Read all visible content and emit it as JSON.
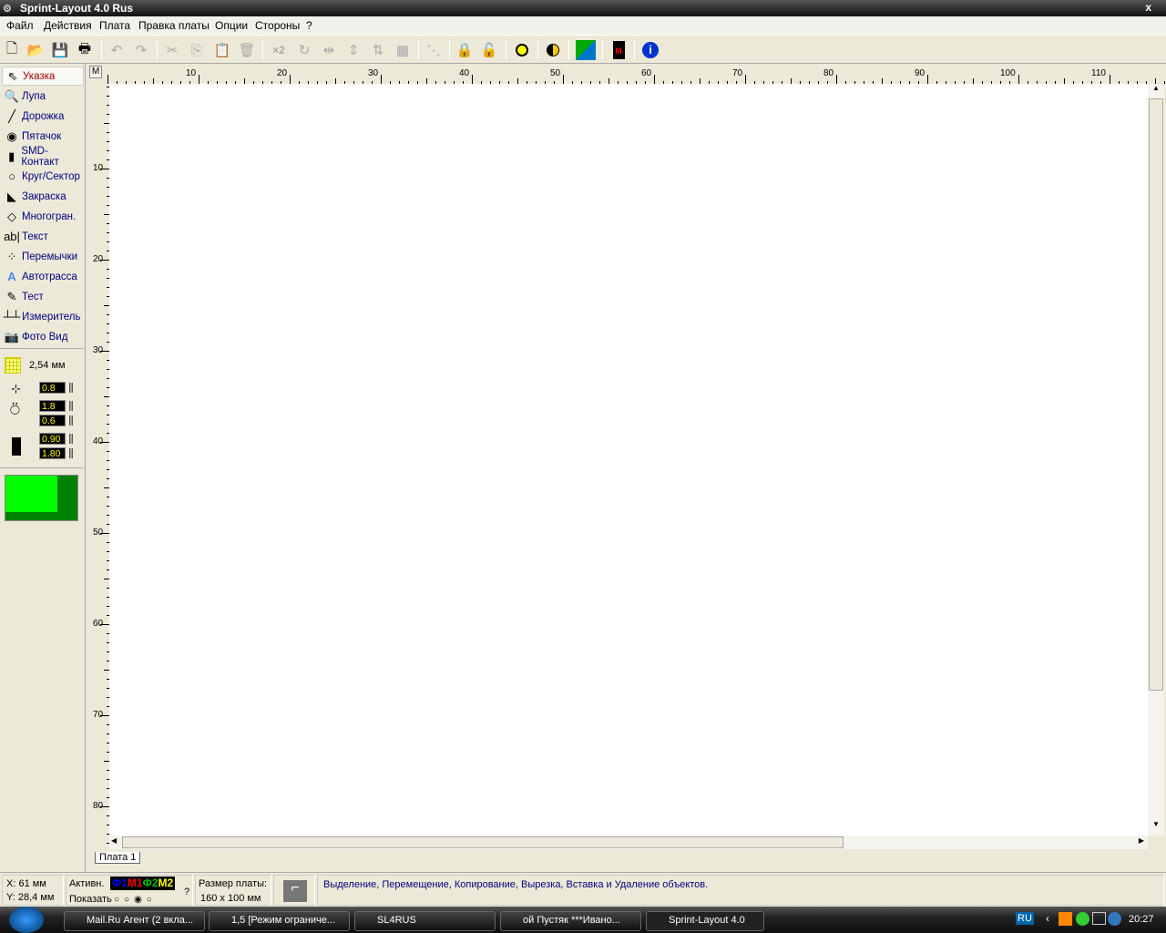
{
  "window": {
    "title": "Sprint-Layout 4.0 Rus",
    "close": "x"
  },
  "menu": [
    "Файл",
    "Действия",
    "Плата",
    "Правка платы",
    "Опции",
    "Стороны",
    "?"
  ],
  "tools": [
    {
      "label": "Указка",
      "icon": "pointer-icon",
      "glyph": "⇖"
    },
    {
      "label": "Лупа",
      "icon": "magnifier-icon",
      "glyph": "🔍"
    },
    {
      "label": "Дорожка",
      "icon": "track-icon",
      "glyph": "╱"
    },
    {
      "label": "Пятачок",
      "icon": "pad-icon",
      "glyph": "◉"
    },
    {
      "label": "SMD-Контакт",
      "icon": "smd-pad-icon",
      "glyph": "▮"
    },
    {
      "label": "Круг/Сектор",
      "icon": "circle-icon",
      "glyph": "○"
    },
    {
      "label": "Закраска",
      "icon": "fill-icon",
      "glyph": "◣"
    },
    {
      "label": "Многогран.",
      "icon": "polygon-icon",
      "glyph": "◇"
    },
    {
      "label": "Текст",
      "icon": "text-icon",
      "glyph": "ab|"
    },
    {
      "label": "Перемычки",
      "icon": "jumper-icon",
      "glyph": "⁘"
    },
    {
      "label": "Автотрасса",
      "icon": "autoroute-icon",
      "glyph": "A"
    },
    {
      "label": "Тест",
      "icon": "test-icon",
      "glyph": "✎"
    },
    {
      "label": "Измеритель",
      "icon": "measure-icon",
      "glyph": "┴┴"
    },
    {
      "label": "Фото Вид",
      "icon": "camera-icon",
      "glyph": "📷"
    }
  ],
  "grid": {
    "value": "2,54 мм"
  },
  "params": {
    "track_width": "0.8",
    "pad_outer": "1.8",
    "pad_inner": "0.6",
    "smd_w": "0.90",
    "smd_h": "1.80"
  },
  "colors": {
    "layer_light": "#00ff00",
    "layer_dark": "#008000"
  },
  "ruler": {
    "unit": "M",
    "top": [
      "10",
      "20",
      "30",
      "40",
      "50",
      "60",
      "70",
      "80",
      "90",
      "100",
      "110"
    ],
    "left": [
      "10",
      "20",
      "30",
      "40",
      "50",
      "60",
      "70",
      "80"
    ]
  },
  "tab": "Плата 1",
  "status": {
    "x": "X: 61 мм",
    "y": "Y: 28,4 мм",
    "active_label": "Активн.",
    "layers": [
      {
        "t": "Ф1",
        "c": "#0000ff"
      },
      {
        "t": "М1",
        "c": "#ff0000"
      },
      {
        "t": "Ф2",
        "c": "#00c000"
      },
      {
        "t": "М2",
        "c": "#ffff00"
      }
    ],
    "show_label": "Показать",
    "help": "?",
    "size_label": "Размер платы:",
    "size_value": "160 x 100 мм",
    "hint": "Выделение, Перемещение, Копирование, Вырезка, Вставка и Удаление объектов."
  },
  "taskbar": {
    "tasks": [
      "Mail.Ru Агент (2 вкла...",
      "1,5 [Режим ограниче...",
      "SL4RUS",
      "ой Пустяк ***Ивано...",
      "Sprint-Layout 4.0"
    ],
    "lang": "RU",
    "clock": "20:27"
  }
}
